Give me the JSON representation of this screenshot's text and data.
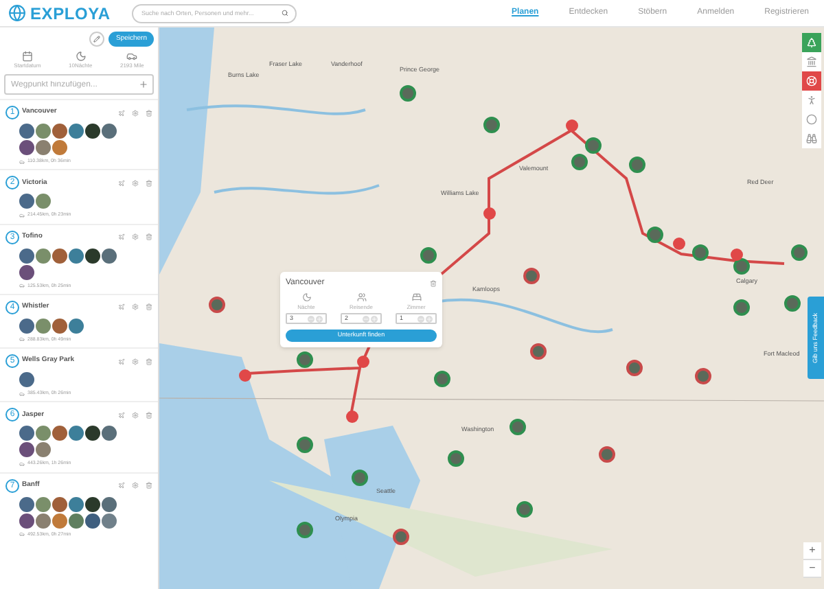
{
  "header": {
    "logo": "EXPLOYA",
    "search": {
      "placeholder": "Suche nach Orten, Personen und mehr..."
    },
    "nav": [
      {
        "label": "Planen",
        "selected": true
      },
      {
        "label": "Entdecken",
        "selected": false
      },
      {
        "label": "Stöbern",
        "selected": false
      },
      {
        "label": "Anmelden",
        "selected": false
      },
      {
        "label": "Registrieren",
        "selected": false
      }
    ]
  },
  "sidebar": {
    "save_button": "Speichern",
    "summary": [
      {
        "kind": "calendar",
        "label": "Startdatum"
      },
      {
        "kind": "moon",
        "label": "10Nächte"
      },
      {
        "kind": "car",
        "label": "2193 Mile"
      }
    ],
    "waypoint": {
      "placeholder": "Wegpunkt hinzufügen..."
    },
    "stops": [
      {
        "number": "1",
        "name": "Vancouver",
        "photos": [
          {
            "kind": "photo"
          },
          {
            "kind": "photo"
          },
          {
            "kind": "photo"
          },
          {
            "kind": "photo"
          },
          {
            "kind": "photo"
          },
          {
            "kind": "photo"
          },
          {
            "kind": "photo"
          },
          {
            "kind": "photo"
          },
          {
            "kind": "photo"
          }
        ],
        "stats": "110.38km, 0h 36min"
      },
      {
        "number": "2",
        "name": "Victoria",
        "photos": [
          {
            "kind": "photo"
          },
          {
            "kind": "photo"
          }
        ],
        "stats": "214.45km, 0h 23min"
      },
      {
        "number": "3",
        "name": "Tofino",
        "photos": [
          {
            "kind": "photo"
          },
          {
            "kind": "photo"
          },
          {
            "kind": "photo"
          },
          {
            "kind": "photo"
          },
          {
            "kind": "photo"
          },
          {
            "kind": "photo"
          },
          {
            "kind": "photo"
          }
        ],
        "stats": "125.53km, 0h 25min"
      },
      {
        "number": "4",
        "name": "Whistler",
        "photos": [
          {
            "kind": "photo"
          },
          {
            "kind": "photo"
          },
          {
            "kind": "photo"
          },
          {
            "kind": "photo"
          }
        ],
        "stats": "288.83km, 0h 49min"
      },
      {
        "number": "5",
        "name": "Wells Gray Park",
        "photos": [
          {
            "kind": "photo"
          }
        ],
        "stats": "385.43km, 0h 26min"
      },
      {
        "number": "6",
        "name": "Jasper",
        "photos": [
          {
            "kind": "photo"
          },
          {
            "kind": "photo"
          },
          {
            "kind": "photo"
          },
          {
            "kind": "photo"
          },
          {
            "kind": "photo"
          },
          {
            "kind": "photo"
          },
          {
            "kind": "photo"
          },
          {
            "kind": "photo"
          }
        ],
        "stats": "443.26km, 1h 26min"
      },
      {
        "number": "7",
        "name": "Banff",
        "photos": [
          {
            "kind": "photo"
          },
          {
            "kind": "photo"
          },
          {
            "kind": "photo"
          },
          {
            "kind": "photo"
          },
          {
            "kind": "photo"
          },
          {
            "kind": "photo"
          },
          {
            "kind": "photo"
          },
          {
            "kind": "photo"
          },
          {
            "kind": "photo"
          },
          {
            "kind": "photo"
          },
          {
            "kind": "photo"
          },
          {
            "kind": "photo"
          }
        ],
        "stats": "492.53km, 0h 27min"
      }
    ]
  },
  "map": {
    "labels": [
      "Burns Lake",
      "Fraser Lake",
      "Vanderhoof",
      "Prince George",
      "Williams Lake",
      "Valemount",
      "Kamloops",
      "Red Deer",
      "Calgary",
      "Fort Macleod",
      "Washington",
      "Seattle",
      "Olympia"
    ],
    "popup": {
      "title": "Vancouver",
      "fields": [
        {
          "kind": "moon",
          "label": "Nächte",
          "value": "3"
        },
        {
          "kind": "people",
          "label": "Reisende",
          "value": "2"
        },
        {
          "kind": "bed",
          "label": "Zimmer",
          "value": "1"
        }
      ],
      "button": "Unterkunft finden"
    },
    "layers": [
      {
        "kind": "tree",
        "selected": true
      },
      {
        "kind": "building",
        "selected": false
      },
      {
        "kind": "lifebuoy",
        "selected": true
      },
      {
        "kind": "person",
        "selected": false
      },
      {
        "kind": "circle",
        "selected": false
      },
      {
        "kind": "binoculars",
        "selected": false
      }
    ],
    "feedback": "Gib uns Feedback",
    "zoom": [
      "+",
      "−"
    ]
  }
}
